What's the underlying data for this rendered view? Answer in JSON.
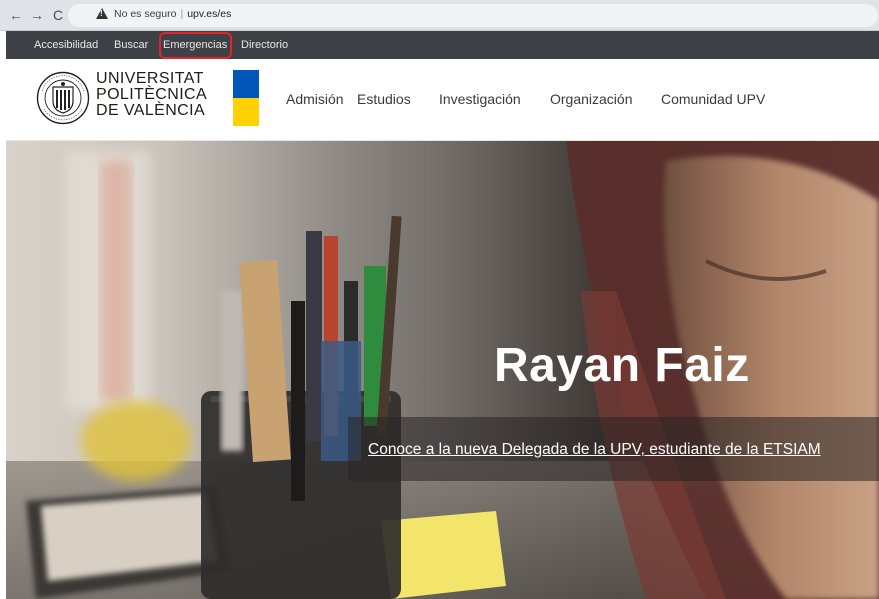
{
  "browser": {
    "back": "←",
    "forward": "→",
    "reload": "C",
    "security_label": "No es seguro",
    "url": "upv.es/es"
  },
  "utility_nav": [
    {
      "label": "Accesibilidad"
    },
    {
      "label": "Buscar"
    },
    {
      "label": "Emergencias"
    },
    {
      "label": "Directorio"
    }
  ],
  "logo": {
    "line1": "UNIVERSITAT",
    "line2": "POLITÈCNICA",
    "line3": "DE VALÈNCIA",
    "seal_text": "UNIVERSITAS POLYTECHNICA VALENTIAE"
  },
  "main_nav": [
    {
      "label": "Admisión"
    },
    {
      "label": "Estudios"
    },
    {
      "label": "Investigación"
    },
    {
      "label": "Organización"
    },
    {
      "label": "Comunidad UPV"
    }
  ],
  "hero": {
    "title": "Rayan Faiz",
    "caption": "Conoce a la nueva Delegada de la UPV, estudiante de la ETSIAM"
  },
  "colors": {
    "utility_bar": "#3d4044",
    "highlight": "#e0252b",
    "flag_blue": "#0057b7",
    "flag_yellow": "#ffd200"
  }
}
